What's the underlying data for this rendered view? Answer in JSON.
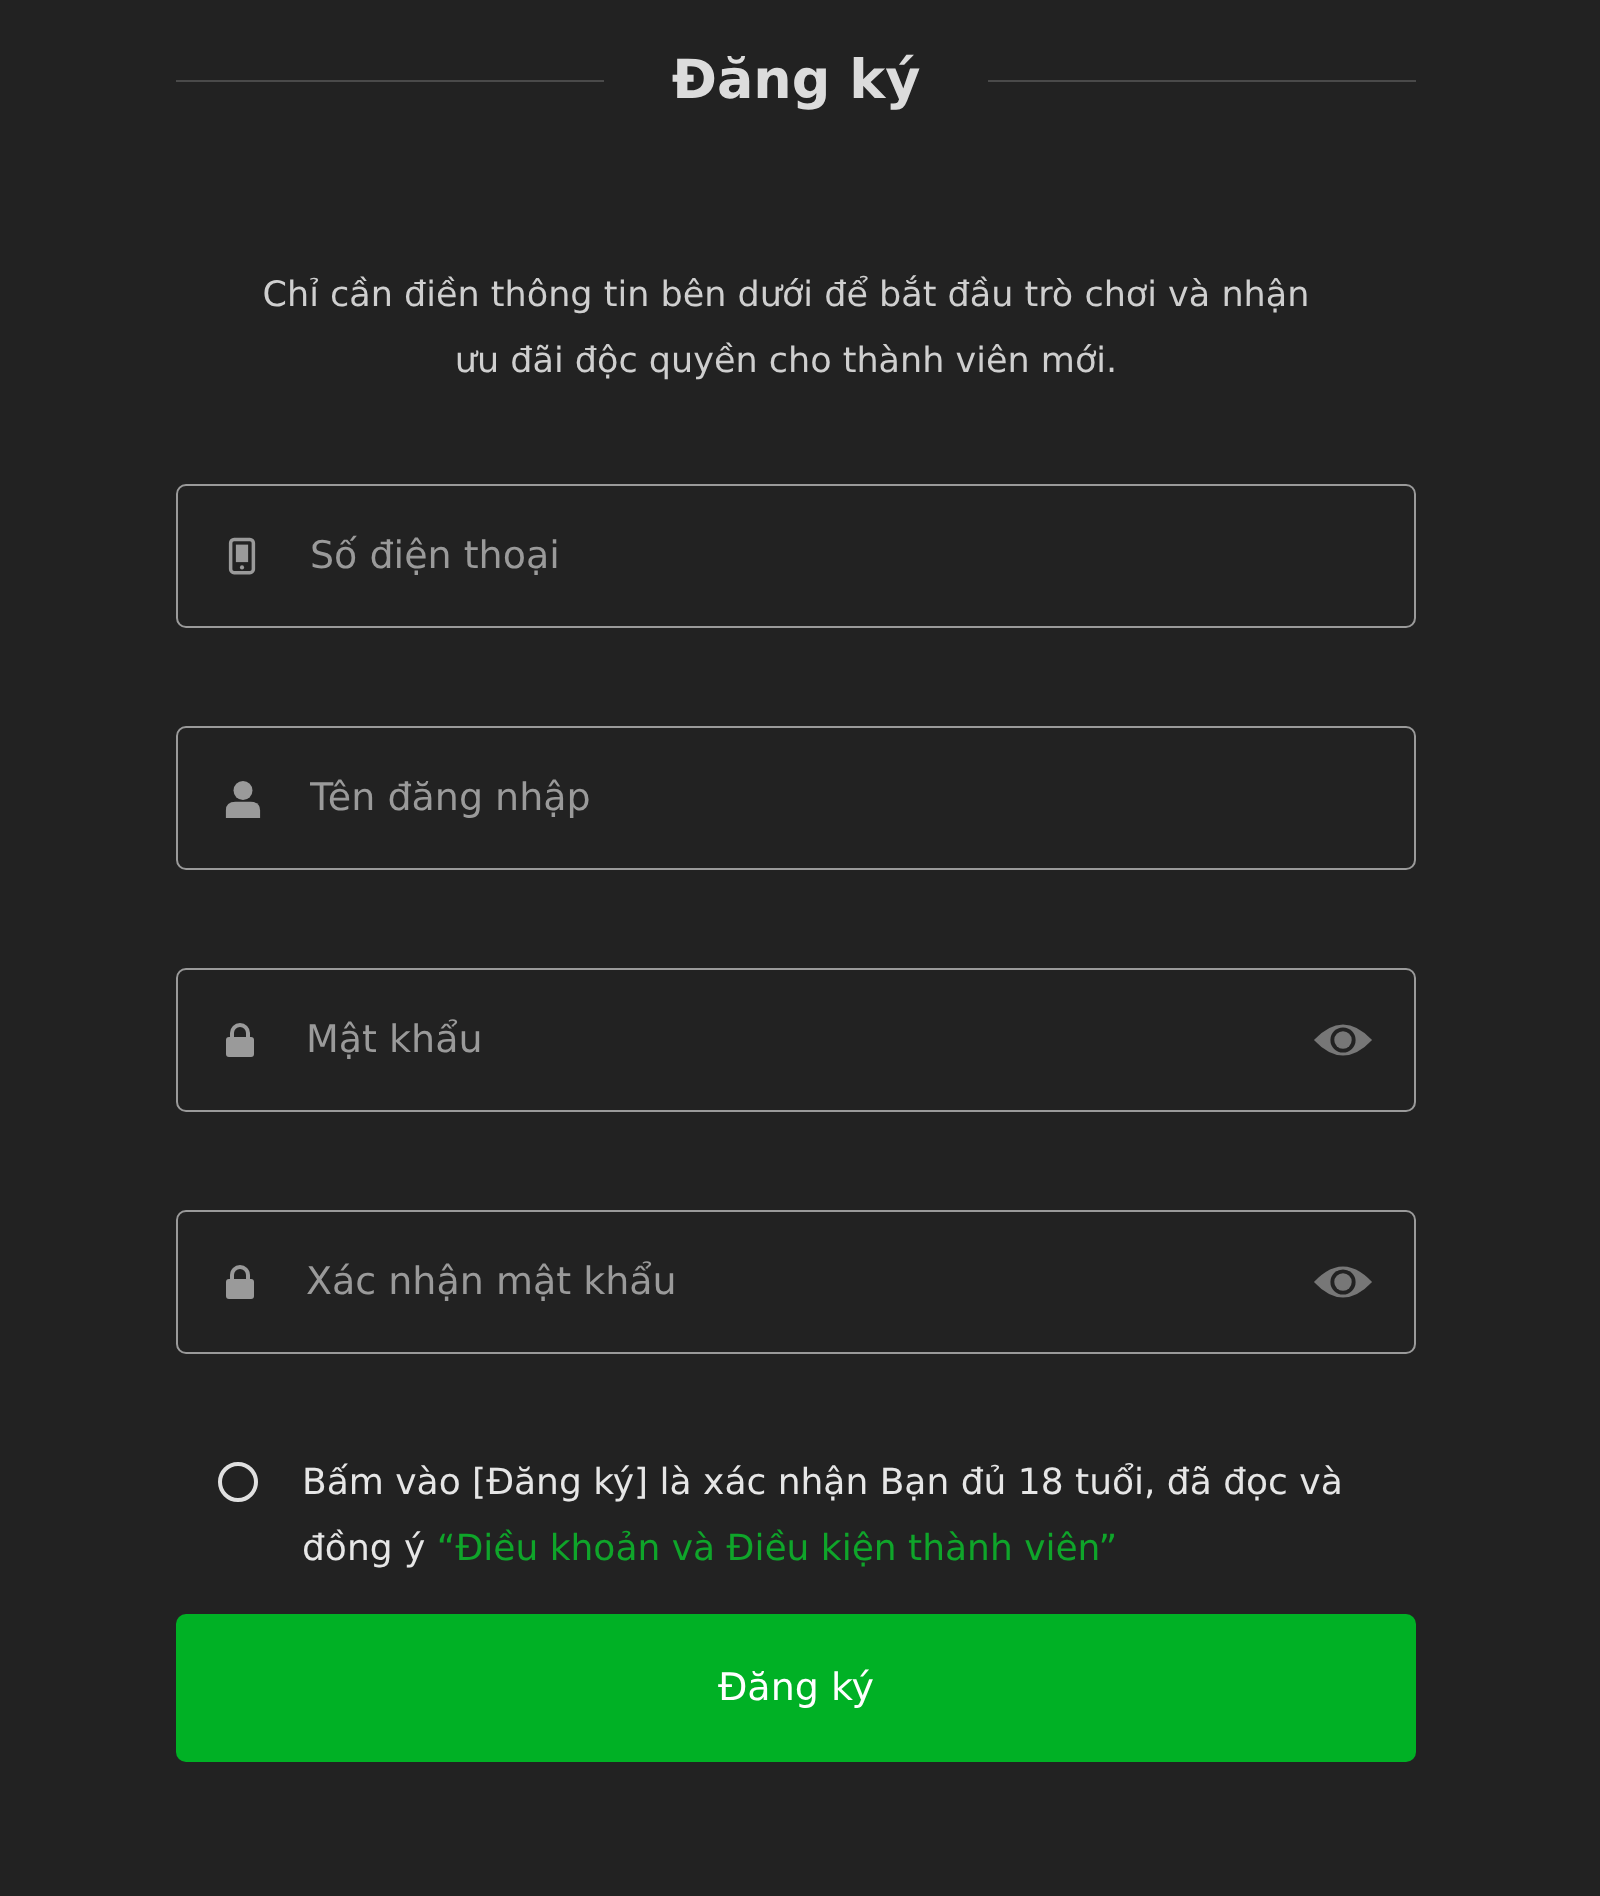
{
  "title": "Đăng ký",
  "description": "Chỉ cần điền thông tin bên dưới để bắt đầu trò chơi và nhận ưu đãi độc quyền cho thành viên mới.",
  "fields": [
    {
      "kind": "phone",
      "placeholder": "Số điện thoại",
      "reveal_toggle": false
    },
    {
      "kind": "user",
      "placeholder": "Tên đăng nhập",
      "reveal_toggle": false
    },
    {
      "kind": "lock",
      "placeholder": "Mật khẩu",
      "reveal_toggle": true
    },
    {
      "kind": "lock",
      "placeholder": "Xác nhận mật khẩu",
      "reveal_toggle": true
    }
  ],
  "agreement": {
    "checked": false,
    "text": "Bấm vào [Đăng ký] là xác nhận Bạn đủ 18 tuổi, đã đọc và đồng ý",
    "link": "“Điều khoản và Điều kiện thành viên”"
  },
  "submit_button": "Đăng ký"
}
